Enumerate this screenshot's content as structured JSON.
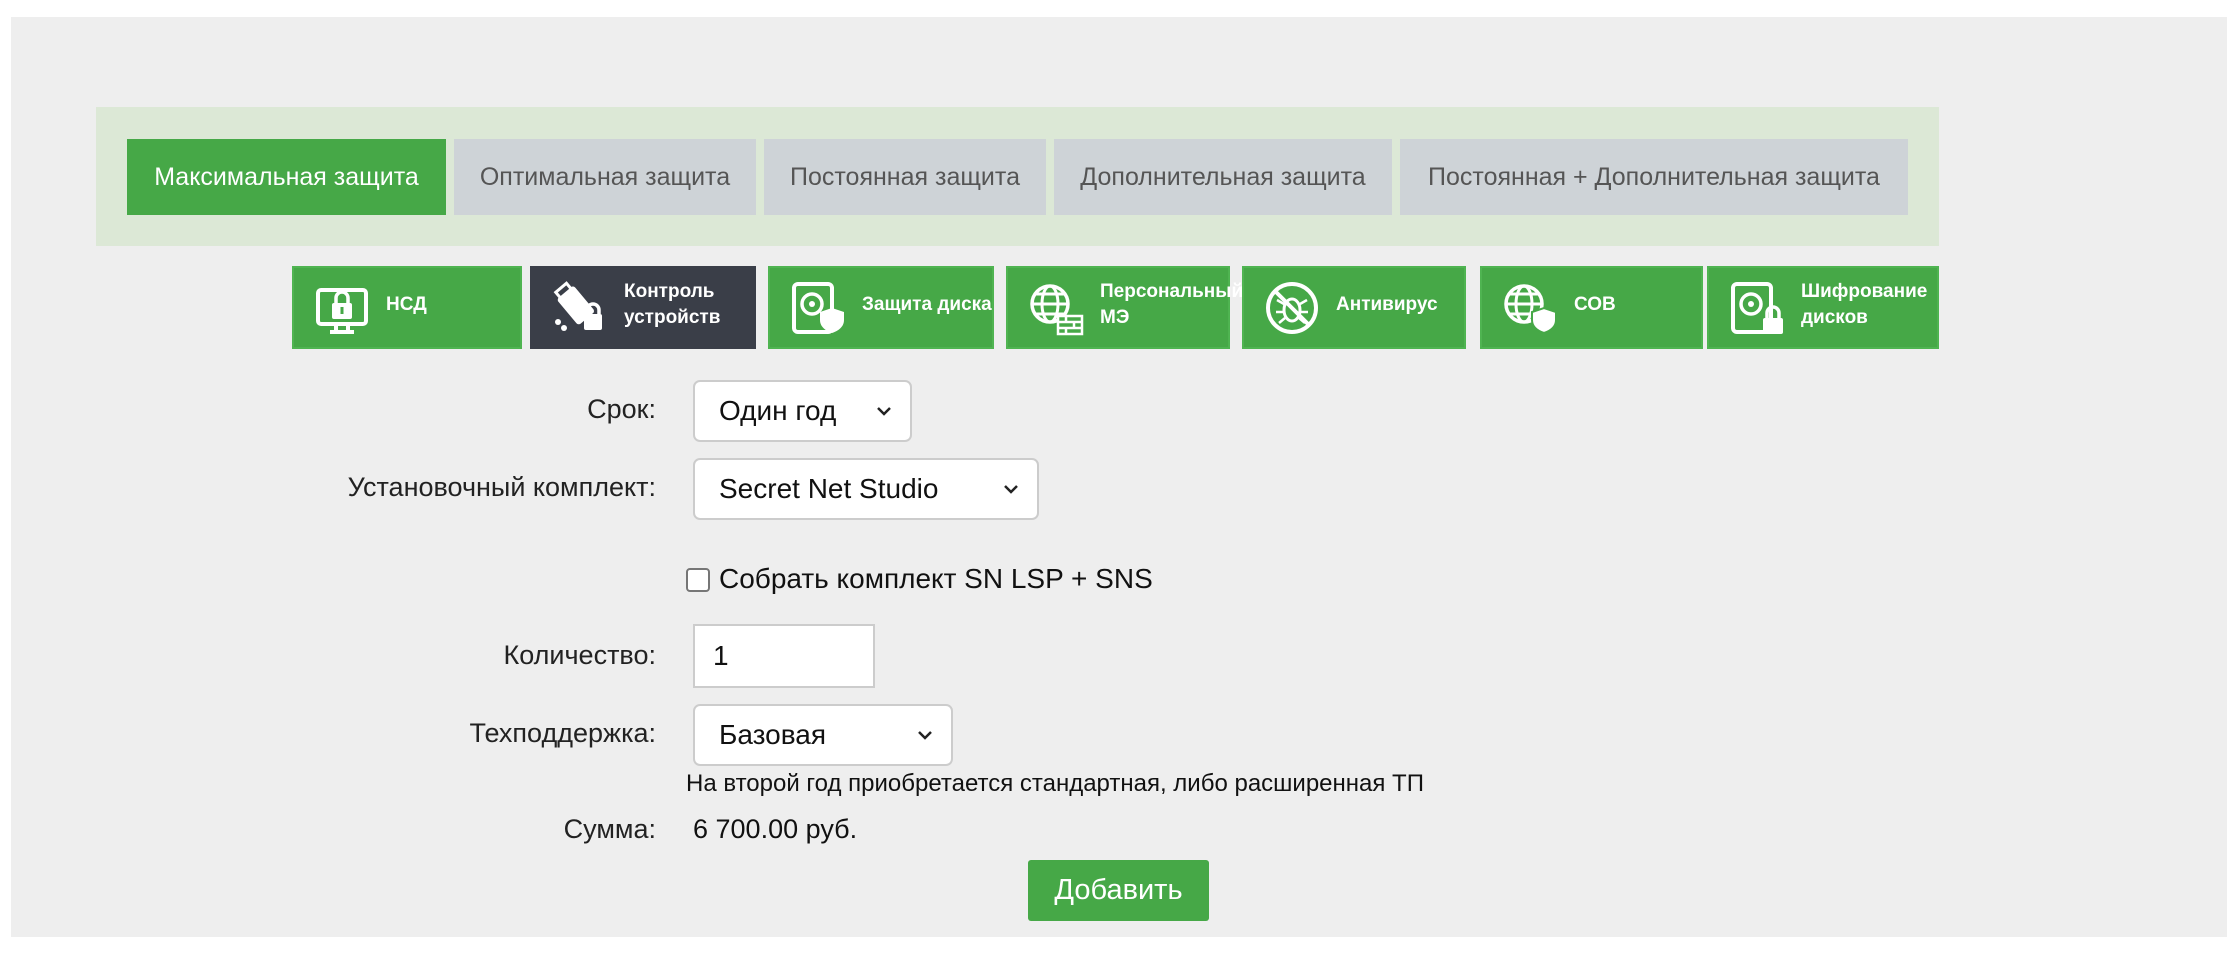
{
  "tabs": [
    {
      "label": "Максимальная защита",
      "active": true
    },
    {
      "label": "Оптимальная защита",
      "active": false
    },
    {
      "label": "Постоянная защита",
      "active": false
    },
    {
      "label": "Дополнительная защита",
      "active": false
    },
    {
      "label": "Постоянная + Дополнительная защита",
      "active": false
    }
  ],
  "products": [
    {
      "label": "НСД",
      "icon": "monitor-lock-icon",
      "active": false
    },
    {
      "label": "Контроль устройств",
      "icon": "usb-lock-icon",
      "active": true
    },
    {
      "label": "Защита диска",
      "icon": "disk-shield-icon",
      "active": false
    },
    {
      "label": "Персональный МЭ",
      "icon": "globe-firewall-icon",
      "active": false
    },
    {
      "label": "Антивирус",
      "icon": "no-bug-icon",
      "active": false
    },
    {
      "label": "СОВ",
      "icon": "globe-shield-icon",
      "active": false
    },
    {
      "label": "Шифрование дисков",
      "icon": "disk-lock-icon",
      "active": false
    }
  ],
  "form": {
    "term_label": "Срок:",
    "term_value": "Один год",
    "kit_label": "Установочный комплект:",
    "kit_value": "Secret Net Studio",
    "bundle_checkbox_label": "Собрать комплект SN LSP + SNS",
    "bundle_checked": false,
    "quantity_label": "Количество:",
    "quantity_value": "1",
    "support_label": "Техподдержка:",
    "support_value": "Базовая",
    "support_note": "На второй год приобретается стандартная, либо расширенная ТП",
    "sum_label": "Сумма:",
    "sum_value": "6 700.00 руб.",
    "add_button": "Добавить"
  },
  "colors": {
    "accent_green": "#46a847",
    "active_dark": "#3a3e48",
    "tab_inactive": "#ced3d7",
    "tabbar_bg": "#dce8d6",
    "panel_bg": "#eeeeee"
  }
}
